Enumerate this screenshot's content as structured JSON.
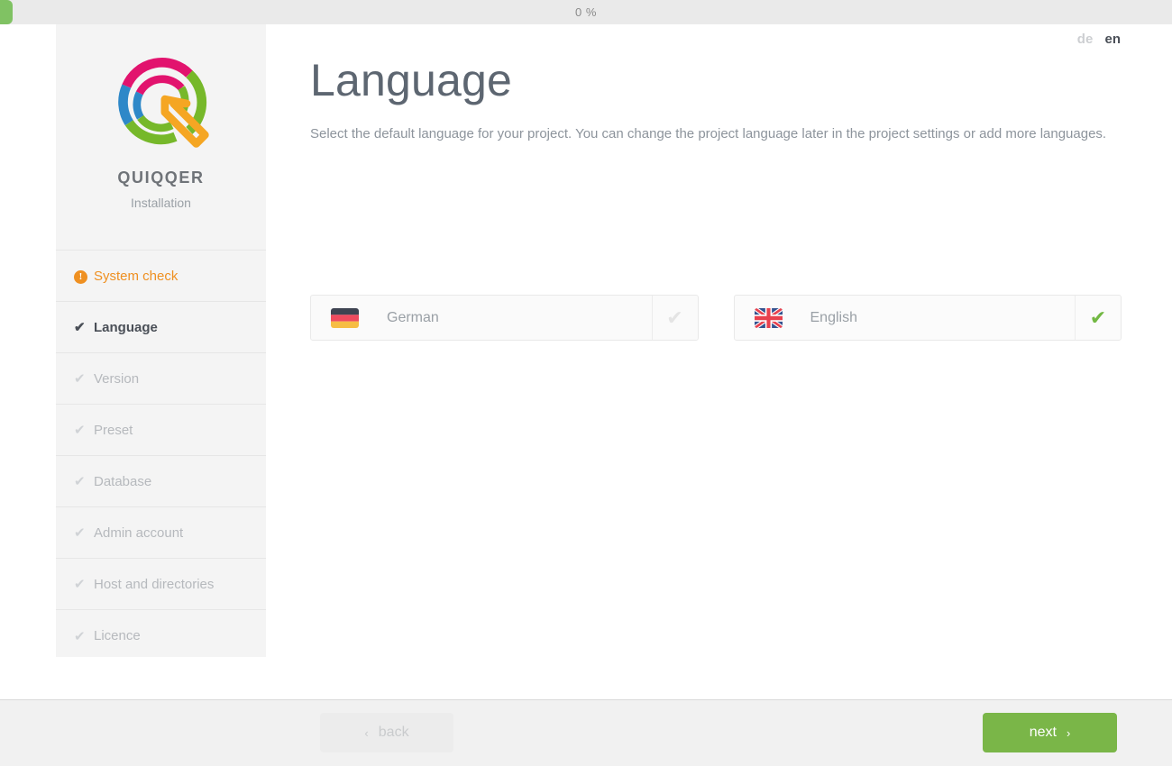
{
  "progress": {
    "percent_label": "0 %",
    "percent_value": 0,
    "fill_color": "#80c263",
    "track_color": "#eaeaea"
  },
  "sidebar": {
    "brand_name": "QUIQQER",
    "brand_subtitle": "Installation",
    "logo_icon": "quiqqer-logo-icon",
    "items": [
      {
        "label": "System check",
        "icon": "alert-circle-icon",
        "state": "warn"
      },
      {
        "label": "Language",
        "icon": "check-icon",
        "state": "active"
      },
      {
        "label": "Version",
        "icon": "check-icon",
        "state": "muted"
      },
      {
        "label": "Preset",
        "icon": "check-icon",
        "state": "muted"
      },
      {
        "label": "Database",
        "icon": "check-icon",
        "state": "muted"
      },
      {
        "label": "Admin account",
        "icon": "check-icon",
        "state": "muted"
      },
      {
        "label": "Host and directories",
        "icon": "check-icon",
        "state": "muted"
      },
      {
        "label": "Licence",
        "icon": "check-icon",
        "state": "muted"
      }
    ]
  },
  "lang_switch": {
    "inactive": "de",
    "active": "en"
  },
  "main": {
    "title": "Language",
    "description": "Select the default language for your project. You can change the project language later in the project settings or add more languages.",
    "languages": [
      {
        "name": "German",
        "flag": "flag-de-icon",
        "selected": false,
        "check_icon": "check-icon"
      },
      {
        "name": "English",
        "flag": "flag-gb-icon",
        "selected": true,
        "check_icon": "check-icon"
      }
    ]
  },
  "footer": {
    "back_label": "back",
    "back_chevron": "‹",
    "back_disabled": true,
    "next_label": "next",
    "next_chevron": "›",
    "next_color": "#7ab648"
  },
  "colors": {
    "accent_green": "#7ab648",
    "warn_orange": "#ef9021",
    "text_dark": "#4a4f57",
    "text_muted": "#9aa0a6",
    "sidebar_bg": "#f4f4f4",
    "footer_bg": "#f1f1f1"
  }
}
